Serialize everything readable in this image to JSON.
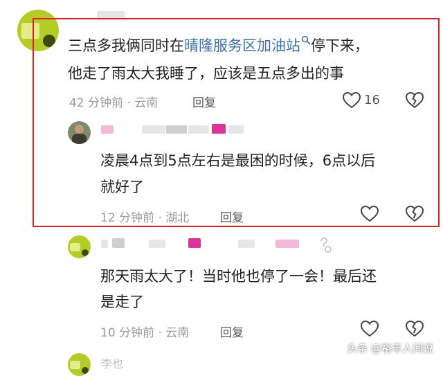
{
  "comments": [
    {
      "text_line1_before": "三点多我俩同时在",
      "link_text": "晴隆服务区加油站",
      "text_line1_after": "停下来，",
      "text_line2": "他走了雨太大我睡了，应该是五点多出的事",
      "time_location": "42 分钟前 · 云南",
      "reply_label": "回复",
      "like_count": "16"
    },
    {
      "text_line1": "凌晨4点到5点左右是最困的时候，6点以后",
      "text_line2": "就好了",
      "time_location": "12 分钟前 · 湖北",
      "reply_label": "回复"
    },
    {
      "text_line1": "那天雨太大了！当时他也停了一会！最后还",
      "text_line2": "是走了",
      "time_location": "10 分钟前 · 云南",
      "reply_label": "回复"
    }
  ],
  "partial_next_username": "李也",
  "watermark": "头条 @裕丰人间说",
  "colors": {
    "highlight": "#e02020",
    "link": "#3a6fb0",
    "meta": "#9a9a9a"
  },
  "icons": [
    "search-icon",
    "heart-outline-icon",
    "broken-heart-icon"
  ]
}
